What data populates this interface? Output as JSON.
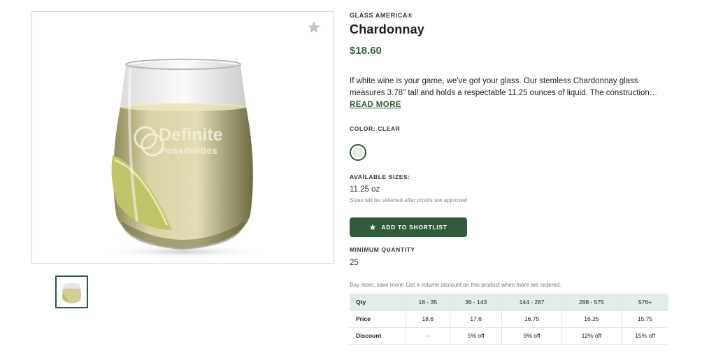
{
  "product": {
    "brand": "GLASS AMERICA®",
    "title": "Chardonnay",
    "price": "$18.60",
    "description": "If white wine is your game, we've got your glass. Our stemless Chardonnay glass measures 3.78\" tall and holds a respectable 11.25 ounces of liquid. The construction…",
    "read_more": "READ MORE",
    "image_imprint": [
      "Definite",
      "Possibilities"
    ]
  },
  "options": {
    "color_label": "COLOR: CLEAR",
    "sizes_label": "AVAILABLE SIZES:",
    "size_value": "11.25 oz",
    "size_note": "Sizes will be selected after proofs are approved"
  },
  "actions": {
    "shortlist_label": "ADD TO SHORTLIST"
  },
  "minimum": {
    "label": "MINIMUM QUANTITY",
    "value": "25"
  },
  "volume": {
    "note": "Buy more, save more! Get a volume discount on this product when more are ordered."
  },
  "pricing_table": {
    "header": [
      "Qty",
      "18 - 35",
      "36 - 143",
      "144 - 287",
      "288 - 575",
      "576+"
    ],
    "rows": [
      [
        "Price",
        "18.6",
        "17.6",
        "16.75",
        "16.25",
        "15.75"
      ],
      [
        "Discount",
        "--",
        "5% off",
        "9% off",
        "12% off",
        "15% off"
      ]
    ]
  },
  "colors": {
    "accent": "#2f5a3b",
    "price": "#2e6b3a",
    "table_header_bg": "#e3ece6"
  },
  "icons": {
    "favorite": "star-icon",
    "shortlist": "star-icon"
  }
}
